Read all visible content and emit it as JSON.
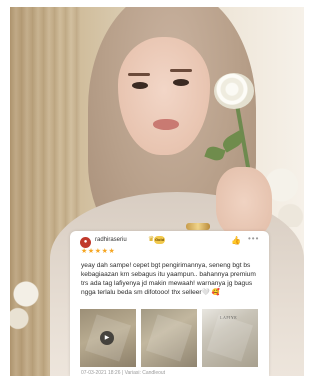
{
  "review": {
    "username": "radhiraseriu",
    "level_badge": "Gold",
    "rating": 5,
    "stars": "★★★★★",
    "text": "yeay dah sampe! cepet bgt pengirimannya, seneng bgt bs kebagiaazan krn sebagus itu yaampun.. bahannya premium trs ada tag lafiyenya jd makin mewaah! warnanya jg bagus ngga terlalu beda sm difotooo! thx selleer🤍",
    "emoji_extra": "🥰",
    "date": "07-03-2021 18:26",
    "variation": "Variasi: Candleout",
    "thumb_box_label": "LAFIYE"
  },
  "icons": {
    "avatar": "user-avatar",
    "badge": "crown-icon",
    "like": "thumbs-up-icon",
    "more": "more-options-icon",
    "play": "play-icon"
  },
  "colors": {
    "star": "#f5a623",
    "badge": "#f2c94c",
    "avatar": "#c0392b"
  }
}
